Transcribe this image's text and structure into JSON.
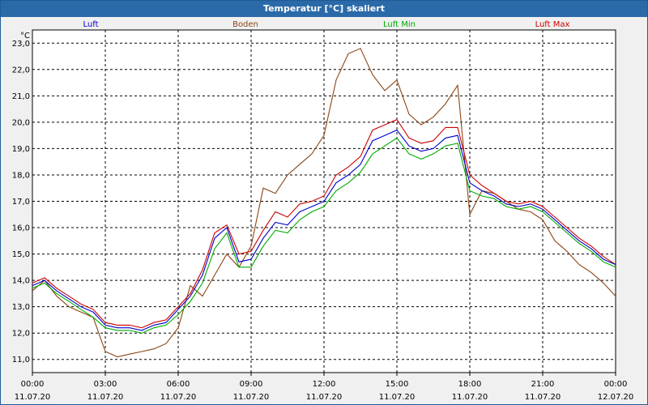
{
  "window": {
    "title": "Temperatur [°C] skaliert"
  },
  "chart_data": {
    "type": "line",
    "title": "Temperatur [°C] skaliert",
    "ylabel": "°C",
    "ylim": [
      10.5,
      23.5
    ],
    "xlim": [
      "11.07.20 00:00",
      "12.07.20 00:00"
    ],
    "grid": true,
    "legend": "top",
    "y_ticks": [
      "11,0",
      "12,0",
      "13,0",
      "14,0",
      "15,0",
      "16,0",
      "17,0",
      "18,0",
      "19,0",
      "20,0",
      "21,0",
      "22,0",
      "23,0"
    ],
    "x_ticks": [
      {
        "time": "00:00",
        "date": "11.07.20"
      },
      {
        "time": "03:00",
        "date": "11.07.20"
      },
      {
        "time": "06:00",
        "date": "11.07.20"
      },
      {
        "time": "09:00",
        "date": "11.07.20"
      },
      {
        "time": "12:00",
        "date": "11.07.20"
      },
      {
        "time": "15:00",
        "date": "11.07.20"
      },
      {
        "time": "18:00",
        "date": "11.07.20"
      },
      {
        "time": "21:00",
        "date": "11.07.20"
      },
      {
        "time": "00:00",
        "date": "12.07.20"
      }
    ],
    "x_hours": [
      0,
      0.5,
      1,
      1.5,
      2,
      2.5,
      3,
      3.5,
      4,
      4.5,
      5,
      5.5,
      6,
      6.5,
      7,
      7.5,
      8,
      8.5,
      9,
      9.5,
      10,
      10.5,
      11,
      11.5,
      12,
      12.5,
      13,
      13.5,
      14,
      14.5,
      15,
      15.5,
      16,
      16.5,
      17,
      17.5,
      18,
      18.5,
      19,
      19.5,
      20,
      20.5,
      21,
      21.5,
      22,
      22.5,
      23,
      23.5,
      24
    ],
    "series": [
      {
        "name": "Luft",
        "color": "#0000cc",
        "values": [
          13.8,
          14.0,
          13.6,
          13.3,
          13.0,
          12.8,
          12.3,
          12.2,
          12.2,
          12.1,
          12.3,
          12.4,
          12.9,
          13.4,
          14.2,
          15.6,
          16.0,
          14.7,
          14.8,
          15.6,
          16.2,
          16.1,
          16.6,
          16.8,
          17.0,
          17.7,
          18.0,
          18.4,
          19.3,
          19.5,
          19.7,
          19.1,
          18.9,
          19.0,
          19.4,
          19.5,
          17.7,
          17.4,
          17.2,
          16.9,
          16.8,
          16.9,
          16.7,
          16.3,
          15.9,
          15.5,
          15.2,
          14.8,
          14.6
        ]
      },
      {
        "name": "Boden",
        "color": "#8b4513",
        "values": [
          13.6,
          14.0,
          13.4,
          13.0,
          12.8,
          12.6,
          11.3,
          11.1,
          11.2,
          11.3,
          11.4,
          11.6,
          12.2,
          13.8,
          13.4,
          14.2,
          15.0,
          14.5,
          15.3,
          17.5,
          17.3,
          18.0,
          18.4,
          18.8,
          19.5,
          21.6,
          22.6,
          22.8,
          21.8,
          21.2,
          21.6,
          20.3,
          19.9,
          20.2,
          20.7,
          21.4,
          16.5,
          17.4,
          17.3,
          17.0,
          16.7,
          16.6,
          16.3,
          15.5,
          15.1,
          14.6,
          14.3,
          13.9,
          13.4
        ]
      },
      {
        "name": "Luft Min",
        "color": "#00aa00",
        "values": [
          13.7,
          13.9,
          13.5,
          13.2,
          12.9,
          12.6,
          12.2,
          12.1,
          12.1,
          12.0,
          12.2,
          12.3,
          12.7,
          13.2,
          13.9,
          15.2,
          15.8,
          14.5,
          14.5,
          15.3,
          15.9,
          15.8,
          16.3,
          16.6,
          16.8,
          17.4,
          17.7,
          18.1,
          18.8,
          19.1,
          19.4,
          18.8,
          18.6,
          18.8,
          19.1,
          19.2,
          17.4,
          17.2,
          17.1,
          16.8,
          16.7,
          16.8,
          16.6,
          16.2,
          15.8,
          15.4,
          15.1,
          14.7,
          14.5
        ]
      },
      {
        "name": "Luft Max",
        "color": "#cc0000",
        "values": [
          13.9,
          14.1,
          13.7,
          13.4,
          13.1,
          12.9,
          12.4,
          12.3,
          12.3,
          12.2,
          12.4,
          12.5,
          13.0,
          13.5,
          14.4,
          15.8,
          16.1,
          15.0,
          15.1,
          15.9,
          16.6,
          16.4,
          16.9,
          17.0,
          17.2,
          18.0,
          18.3,
          18.7,
          19.7,
          19.9,
          20.1,
          19.4,
          19.2,
          19.3,
          19.8,
          19.8,
          18.0,
          17.6,
          17.3,
          17.0,
          16.9,
          17.0,
          16.8,
          16.4,
          16.0,
          15.6,
          15.3,
          14.9,
          14.6
        ]
      }
    ]
  }
}
